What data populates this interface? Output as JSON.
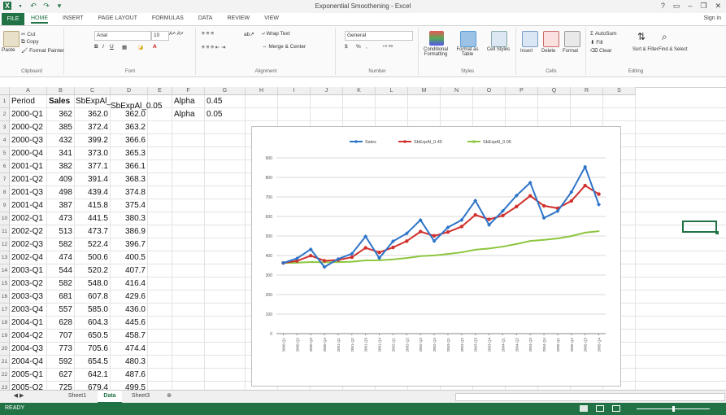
{
  "window": {
    "title": "Exponential Smoothening - Excel",
    "help": "?",
    "minimize": "–",
    "restore": "❐",
    "close": "✕",
    "sign_in": "Sign in"
  },
  "ribbon_tabs": [
    "FILE",
    "HOME",
    "INSERT",
    "PAGE LAYOUT",
    "FORMULAS",
    "DATA",
    "REVIEW",
    "VIEW"
  ],
  "ribbon": {
    "clipboard": {
      "cut": "Cut",
      "copy": "Copy",
      "format_painter": "Format Painter",
      "paste": "Paste",
      "label": "Clipboard"
    },
    "font": {
      "name": "Arial",
      "size": "10",
      "label": "Font"
    },
    "alignment": {
      "wrap": "Wrap Text",
      "merge": "Merge & Center",
      "label": "Alignment"
    },
    "number": {
      "format": "General",
      "label": "Number",
      "currency": "$",
      "percent": "%",
      "comma": ","
    },
    "styles": {
      "conditional": "Conditional Formatting",
      "format_table": "Format as Table",
      "cell_styles": "Cell Styles",
      "label": "Styles"
    },
    "cells": {
      "insert": "Insert",
      "delete": "Delete",
      "format": "Format",
      "label": "Cells"
    },
    "editing": {
      "autosum": "AutoSum",
      "fill": "Fill",
      "clear": "Clear",
      "sort": "Sort & Filter",
      "find": "Find & Select",
      "label": "Editing"
    }
  },
  "columns": [
    "A",
    "B",
    "C",
    "D",
    "E",
    "F",
    "G",
    "H",
    "I",
    "J",
    "K",
    "L",
    "M",
    "N",
    "O",
    "P",
    "Q",
    "R",
    "S"
  ],
  "header_row": {
    "period": "Period",
    "sales": "Sales",
    "c": "SbExpAl_0.45",
    "d": "SbExpAl_0.05",
    "f1": "Alpha",
    "g1": "0.45",
    "f2": "Alpha",
    "g2": "0.05"
  },
  "rows": [
    {
      "period": "2000-Q1",
      "sales": "362",
      "c": "362.0",
      "d": "362.0"
    },
    {
      "period": "2000-Q2",
      "sales": "385",
      "c": "372.4",
      "d": "363.2"
    },
    {
      "period": "2000-Q3",
      "sales": "432",
      "c": "399.2",
      "d": "366.6"
    },
    {
      "period": "2000-Q4",
      "sales": "341",
      "c": "373.0",
      "d": "365.3"
    },
    {
      "period": "2001-Q1",
      "sales": "382",
      "c": "377.1",
      "d": "366.1"
    },
    {
      "period": "2001-Q2",
      "sales": "409",
      "c": "391.4",
      "d": "368.3"
    },
    {
      "period": "2001-Q3",
      "sales": "498",
      "c": "439.4",
      "d": "374.8"
    },
    {
      "period": "2001-Q4",
      "sales": "387",
      "c": "415.8",
      "d": "375.4"
    },
    {
      "period": "2002-Q1",
      "sales": "473",
      "c": "441.5",
      "d": "380.3"
    },
    {
      "period": "2002-Q2",
      "sales": "513",
      "c": "473.7",
      "d": "386.9"
    },
    {
      "period": "2002-Q3",
      "sales": "582",
      "c": "522.4",
      "d": "396.7"
    },
    {
      "period": "2002-Q4",
      "sales": "474",
      "c": "500.6",
      "d": "400.5"
    },
    {
      "period": "2003-Q1",
      "sales": "544",
      "c": "520.2",
      "d": "407.7"
    },
    {
      "period": "2003-Q2",
      "sales": "582",
      "c": "548.0",
      "d": "416.4"
    },
    {
      "period": "2003-Q3",
      "sales": "681",
      "c": "607.8",
      "d": "429.6"
    },
    {
      "period": "2003-Q4",
      "sales": "557",
      "c": "585.0",
      "d": "436.0"
    },
    {
      "period": "2004-Q1",
      "sales": "628",
      "c": "604.3",
      "d": "445.6"
    },
    {
      "period": "2004-Q2",
      "sales": "707",
      "c": "650.5",
      "d": "458.7"
    },
    {
      "period": "2004-Q3",
      "sales": "773",
      "c": "705.6",
      "d": "474.4"
    },
    {
      "period": "2004-Q4",
      "sales": "592",
      "c": "654.5",
      "d": "480.3"
    },
    {
      "period": "2005-Q1",
      "sales": "627",
      "c": "642.1",
      "d": "487.6"
    },
    {
      "period": "2005-Q2",
      "sales": "725",
      "c": "679.4",
      "d": "499.5"
    },
    {
      "period": "2005-Q3",
      "sales": "854",
      "c": "758.0",
      "d": "517.2"
    },
    {
      "period": "2005-Q4",
      "sales": "661",
      "c": "714.3",
      "d": "524.4"
    }
  ],
  "sheet_tabs": [
    "Sheet1",
    "Data",
    "Sheet3"
  ],
  "active_sheet": "Data",
  "add_sheet": "⊕",
  "status": {
    "ready": "READY"
  },
  "colors": {
    "excel_green": "#217346",
    "sales": "#2e74c8",
    "alpha045": "#d0312d",
    "alpha005": "#8dc63f"
  },
  "chart_data": {
    "type": "line",
    "categories": [
      "2000-Q1",
      "2000-Q2",
      "2000-Q3",
      "2000-Q4",
      "2001-Q1",
      "2001-Q2",
      "2001-Q3",
      "2001-Q4",
      "2002-Q1",
      "2002-Q2",
      "2002-Q3",
      "2002-Q4",
      "2003-Q1",
      "2003-Q2",
      "2003-Q3",
      "2003-Q4",
      "2004-Q1",
      "2004-Q2",
      "2004-Q3",
      "2004-Q4",
      "2005-Q1",
      "2005-Q2",
      "2005-Q3",
      "2005-Q4"
    ],
    "series": [
      {
        "name": "Sales",
        "color": "#2e74c8",
        "values": [
          362,
          385,
          432,
          341,
          382,
          409,
          498,
          387,
          473,
          513,
          582,
          474,
          544,
          582,
          681,
          557,
          628,
          707,
          773,
          592,
          627,
          725,
          854,
          661
        ]
      },
      {
        "name": "SbExpAl_0.45",
        "color": "#d0312d",
        "values": [
          362.0,
          372.4,
          399.2,
          373.0,
          377.1,
          391.4,
          439.4,
          415.8,
          441.5,
          473.7,
          522.4,
          500.6,
          520.2,
          548.0,
          607.8,
          585.0,
          604.3,
          650.5,
          705.6,
          654.5,
          642.1,
          679.4,
          758.0,
          714.3
        ]
      },
      {
        "name": "SbExpAl_0.05",
        "color": "#8dc63f",
        "values": [
          362.0,
          363.2,
          366.6,
          365.3,
          366.1,
          368.3,
          374.8,
          375.4,
          380.3,
          386.9,
          396.7,
          400.5,
          407.7,
          416.4,
          429.6,
          436.0,
          445.6,
          458.7,
          474.4,
          480.3,
          487.6,
          499.5,
          517.2,
          524.4
        ]
      }
    ],
    "ylim": [
      0,
      900
    ],
    "yticks": [
      "0",
      "100",
      "200",
      "300",
      "400",
      "500",
      "600",
      "700",
      "800",
      "900"
    ],
    "legend": "top",
    "grid": true
  }
}
